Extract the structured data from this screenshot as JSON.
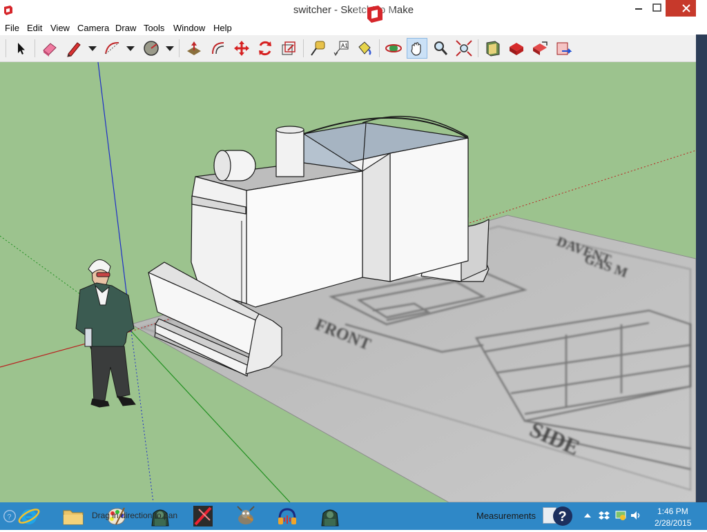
{
  "window": {
    "title": "switcher - SketchUp Make"
  },
  "menu": [
    "File",
    "Edit",
    "View",
    "Camera",
    "Draw",
    "Tools",
    "Window",
    "Help"
  ],
  "toolbar": {
    "tools": [
      "select-tool",
      "eraser-tool",
      "pencil-tool",
      "arc-tool",
      "shapes-tool",
      "push-pull-tool",
      "offset-tool",
      "move-tool",
      "rotate-tool",
      "scale-tool",
      "tape-measure-tool",
      "text-tool",
      "paint-bucket-tool",
      "orbit-tool",
      "pan-tool",
      "zoom-tool",
      "zoom-extents-tool",
      "warehouse-tool",
      "extension-warehouse-tool",
      "share-model-tool",
      "layout-tool"
    ],
    "active_tool": "pan-tool"
  },
  "model": {
    "plan_labels": {
      "front": "FRONT",
      "side": "SIDE",
      "title_line1": "DAVENT",
      "title_line2": "GAS M"
    }
  },
  "status": {
    "hint": "Drag in direction to pan",
    "measurements_label": "Measurements"
  },
  "taskbar": {
    "apps": [
      "internet-explorer",
      "file-explorer",
      "paint",
      "gimp-app",
      "sketchup-tool-app",
      "gimp-wilber",
      "audacity",
      "gimp-app-2",
      "sketchup-make"
    ],
    "active_app": "sketchup-make"
  },
  "clock": {
    "time": "1:46 PM",
    "date": "2/28/2015"
  },
  "colors": {
    "ground": "#9cc38e",
    "taskbar": "#2f88c7",
    "close_button": "#c7392b",
    "axis_red": "#b9201f",
    "axis_green": "#1f8f1f",
    "axis_blue": "#1e2ec8"
  }
}
